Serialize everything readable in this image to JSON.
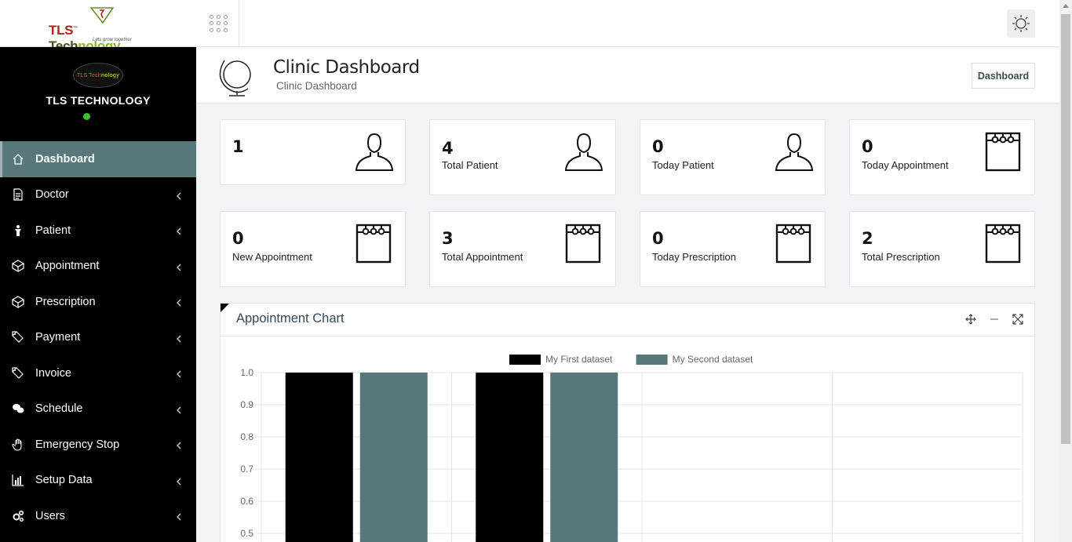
{
  "brand": {
    "logo_main": "TLS",
    "logo_tech": "Tech",
    "logo_nology": "nology",
    "logo_tagline": "Lets grow together",
    "avatar_text_a": "TLS Tech",
    "avatar_text_b": "nology"
  },
  "sidebar": {
    "profile_name": "TLS TECHNOLOGY",
    "items": [
      {
        "label": "Dashboard",
        "icon": "home-icon"
      },
      {
        "label": "Doctor",
        "icon": "document-icon"
      },
      {
        "label": "Patient",
        "icon": "person-icon"
      },
      {
        "label": "Appointment",
        "icon": "cube-icon"
      },
      {
        "label": "Prescription",
        "icon": "cube-icon"
      },
      {
        "label": "Payment",
        "icon": "tag-icon"
      },
      {
        "label": "Invoice",
        "icon": "tag-icon"
      },
      {
        "label": "Schedule",
        "icon": "chat-icon"
      },
      {
        "label": "Emergency Stop",
        "icon": "hand-icon"
      },
      {
        "label": "Setup Data",
        "icon": "bar-chart-icon"
      },
      {
        "label": "Users",
        "icon": "gears-icon"
      }
    ]
  },
  "header": {
    "title": "Clinic Dashboard",
    "subtitle": "Clinic Dashboard",
    "breadcrumb": "Dashboard"
  },
  "cards": [
    {
      "value": "1",
      "label": "",
      "icon": "user-icon"
    },
    {
      "value": "4",
      "label": "Total Patient",
      "icon": "user-icon"
    },
    {
      "value": "0",
      "label": "Today Patient",
      "icon": "user-icon"
    },
    {
      "value": "0",
      "label": "Today Appointment",
      "icon": "calendar-icon"
    },
    {
      "value": "0",
      "label": "New Appointment",
      "icon": "calendar-icon"
    },
    {
      "value": "3",
      "label": "Total Appointment",
      "icon": "calendar-icon"
    },
    {
      "value": "0",
      "label": "Today Prescription",
      "icon": "calendar-icon"
    },
    {
      "value": "2",
      "label": "Total Prescription",
      "icon": "calendar-icon"
    }
  ],
  "panel": {
    "title": "Appointment Chart"
  },
  "colors": {
    "sidebar_bg": "#000000",
    "active": "#57777a",
    "series1": "#000000",
    "series2": "#57777a"
  },
  "chart_data": {
    "type": "bar",
    "categories": [
      "",
      "",
      "",
      ""
    ],
    "series": [
      {
        "name": "My First dataset",
        "values": [
          1,
          1,
          null,
          null
        ]
      },
      {
        "name": "My Second dataset",
        "values": [
          1,
          1,
          null,
          null
        ]
      }
    ],
    "yticks": [
      "1.0",
      "0.9",
      "0.8",
      "0.7",
      "0.6",
      "0.5"
    ],
    "ylim": [
      0,
      1
    ],
    "legend": "top-center",
    "grid": true
  }
}
